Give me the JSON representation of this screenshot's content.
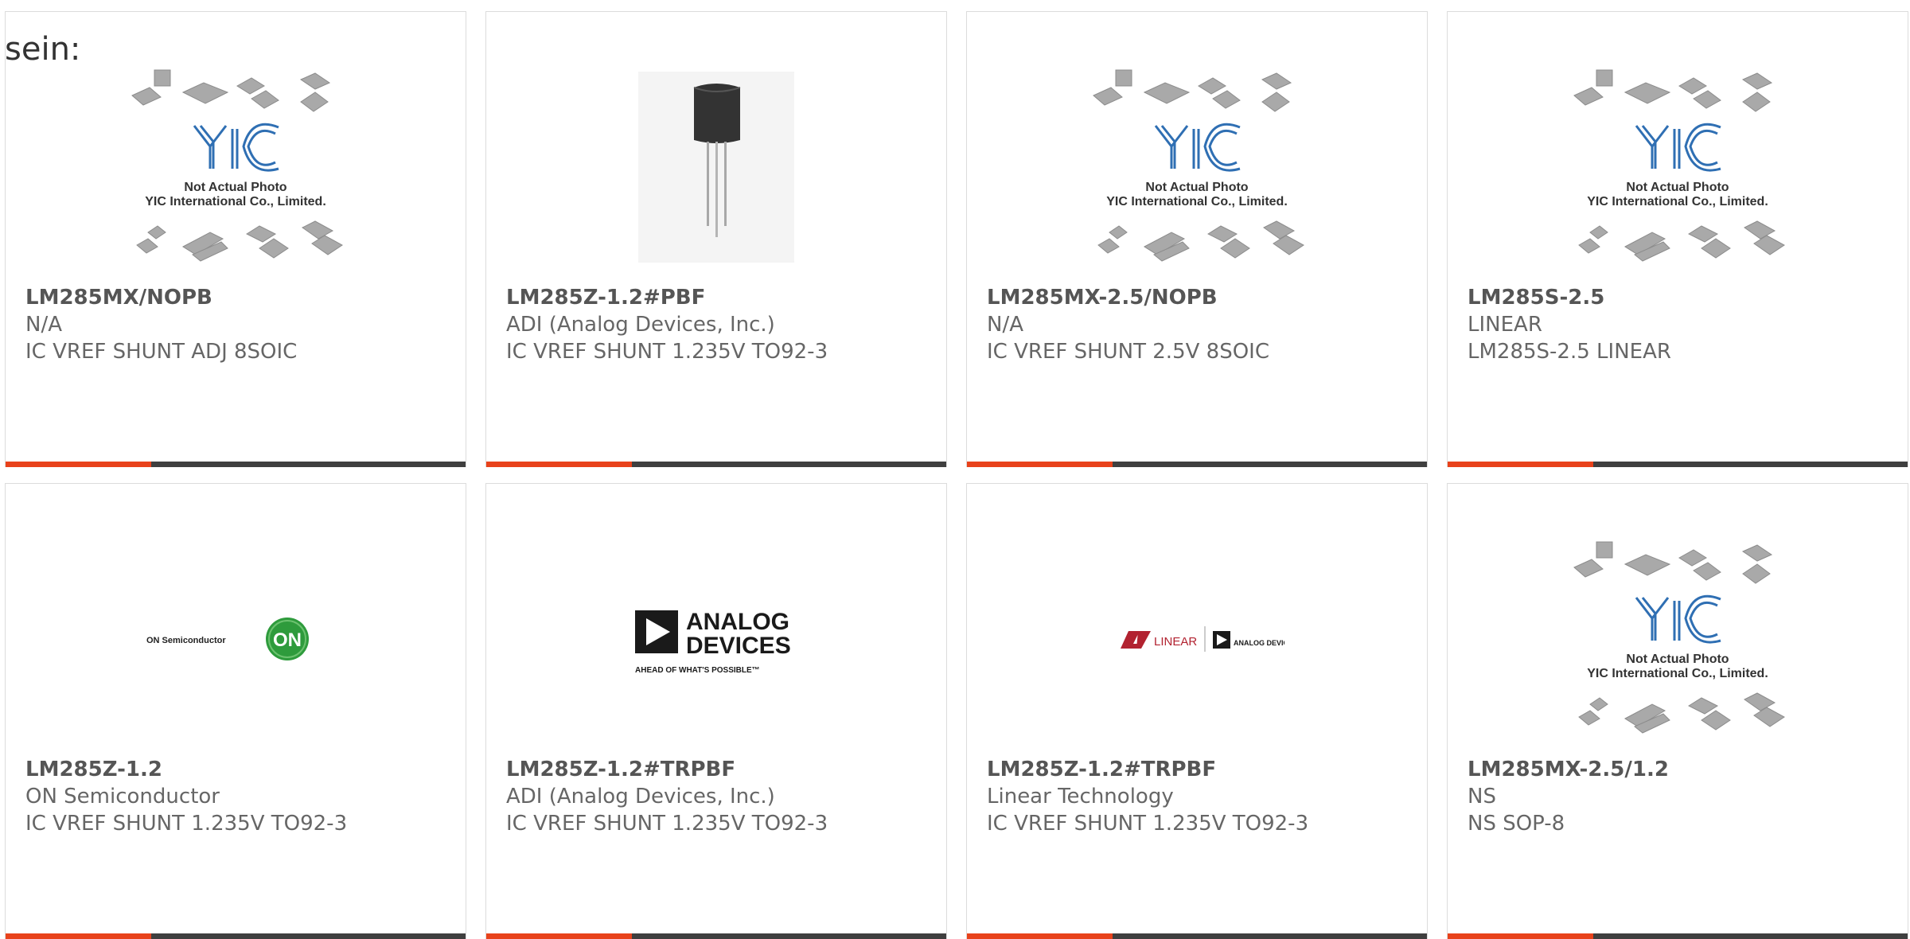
{
  "lead_text": "sein:",
  "accent_color": "#e8421b",
  "bar_color": "#3f3f3f",
  "placeholder": {
    "line1": "Not Actual Photo",
    "line2": "YIC International Co., Limited."
  },
  "logo_text": {
    "on_semi": "ON Semiconductor",
    "on_badge": "ON",
    "analog_line1": "ANALOG",
    "analog_line2": "DEVICES",
    "analog_tagline": "AHEAD OF WHAT'S POSSIBLE™",
    "linear_small_left": "LINEAR",
    "linear_small_right": "ANALOG DEVICES"
  },
  "products": [
    {
      "part": "LM285MX/NOPB",
      "manufacturer": "N/A",
      "description": "IC VREF SHUNT ADJ 8SOIC",
      "image": "yic-placeholder"
    },
    {
      "part": "LM285Z-1.2#PBF",
      "manufacturer": "ADI (Analog Devices, Inc.)",
      "description": "IC VREF SHUNT 1.235V TO92-3",
      "image": "to92-transistor"
    },
    {
      "part": "LM285MX-2.5/NOPB",
      "manufacturer": "N/A",
      "description": "IC VREF SHUNT 2.5V 8SOIC",
      "image": "yic-placeholder"
    },
    {
      "part": "LM285S-2.5",
      "manufacturer": "LINEAR",
      "description": "LM285S-2.5 LINEAR",
      "image": "yic-placeholder"
    },
    {
      "part": "LM285Z-1.2",
      "manufacturer": "ON Semiconductor",
      "description": "IC VREF SHUNT 1.235V TO92-3",
      "image": "on-semi-logo"
    },
    {
      "part": "LM285Z-1.2#TRPBF",
      "manufacturer": "ADI (Analog Devices, Inc.)",
      "description": "IC VREF SHUNT 1.235V TO92-3",
      "image": "analog-devices-logo"
    },
    {
      "part": "LM285Z-1.2#TRPBF",
      "manufacturer": "Linear Technology",
      "description": "IC VREF SHUNT 1.235V TO92-3",
      "image": "linear-analog-logo"
    },
    {
      "part": "LM285MX-2.5/1.2",
      "manufacturer": "NS",
      "description": "NS SOP-8",
      "image": "yic-placeholder"
    }
  ]
}
